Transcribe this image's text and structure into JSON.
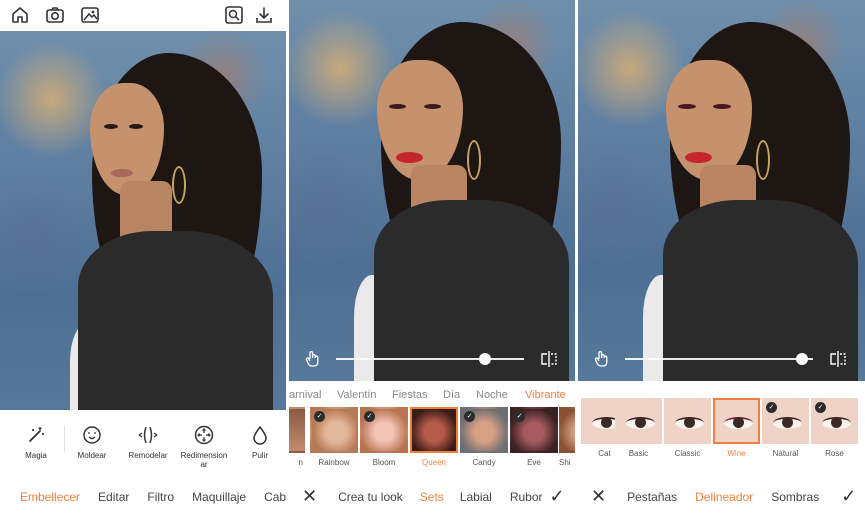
{
  "panel1": {
    "top_icons": [
      "home-icon",
      "camera-icon",
      "gallery-icon",
      "zoom-icon",
      "download-icon"
    ],
    "tools": [
      {
        "label": "Magia",
        "icon": "magic-wand-icon"
      },
      {
        "label": "Moldear",
        "icon": "face-smile-icon"
      },
      {
        "label": "Remodelar",
        "icon": "reshape-icon"
      },
      {
        "label": "Redimension ar",
        "icon": "resize-icon"
      },
      {
        "label": "Pulir",
        "icon": "drop-icon"
      }
    ],
    "nav": [
      "Embellecer",
      "Editar",
      "Filtro",
      "Maquillaje",
      "Cabe"
    ],
    "nav_active": "Embellecer"
  },
  "panel2": {
    "slider_value": 0.79,
    "categories": [
      "arnival",
      "Valentín",
      "Fiestas",
      "Día",
      "Noche",
      "Vibrante"
    ],
    "category_active": "Vibrante",
    "thumbs": [
      {
        "label": "n",
        "checked": false
      },
      {
        "label": "Rainbow",
        "checked": true
      },
      {
        "label": "Bloom",
        "checked": true
      },
      {
        "label": "Queen",
        "checked": false,
        "active": true
      },
      {
        "label": "Candy",
        "checked": true
      },
      {
        "label": "Eve",
        "checked": true
      },
      {
        "label": "Shi",
        "checked": false
      }
    ],
    "nav": [
      "Crea tu look",
      "Sets",
      "Labial",
      "Rubor"
    ],
    "nav_active": "Sets"
  },
  "panel3": {
    "slider_value": 0.94,
    "thumbs": [
      {
        "label": "Cat",
        "checked": false
      },
      {
        "label": "Basic",
        "checked": false
      },
      {
        "label": "Classic",
        "checked": false
      },
      {
        "label": "Wine",
        "checked": false,
        "active": true
      },
      {
        "label": "Natural",
        "checked": true
      },
      {
        "label": "Rose",
        "checked": true
      }
    ],
    "nav": [
      "Pestañas",
      "Delineador",
      "Sombras"
    ],
    "nav_active": "Delineador"
  },
  "colors": {
    "accent": "#f47f3d",
    "text": "#444444",
    "muted": "#888888"
  }
}
